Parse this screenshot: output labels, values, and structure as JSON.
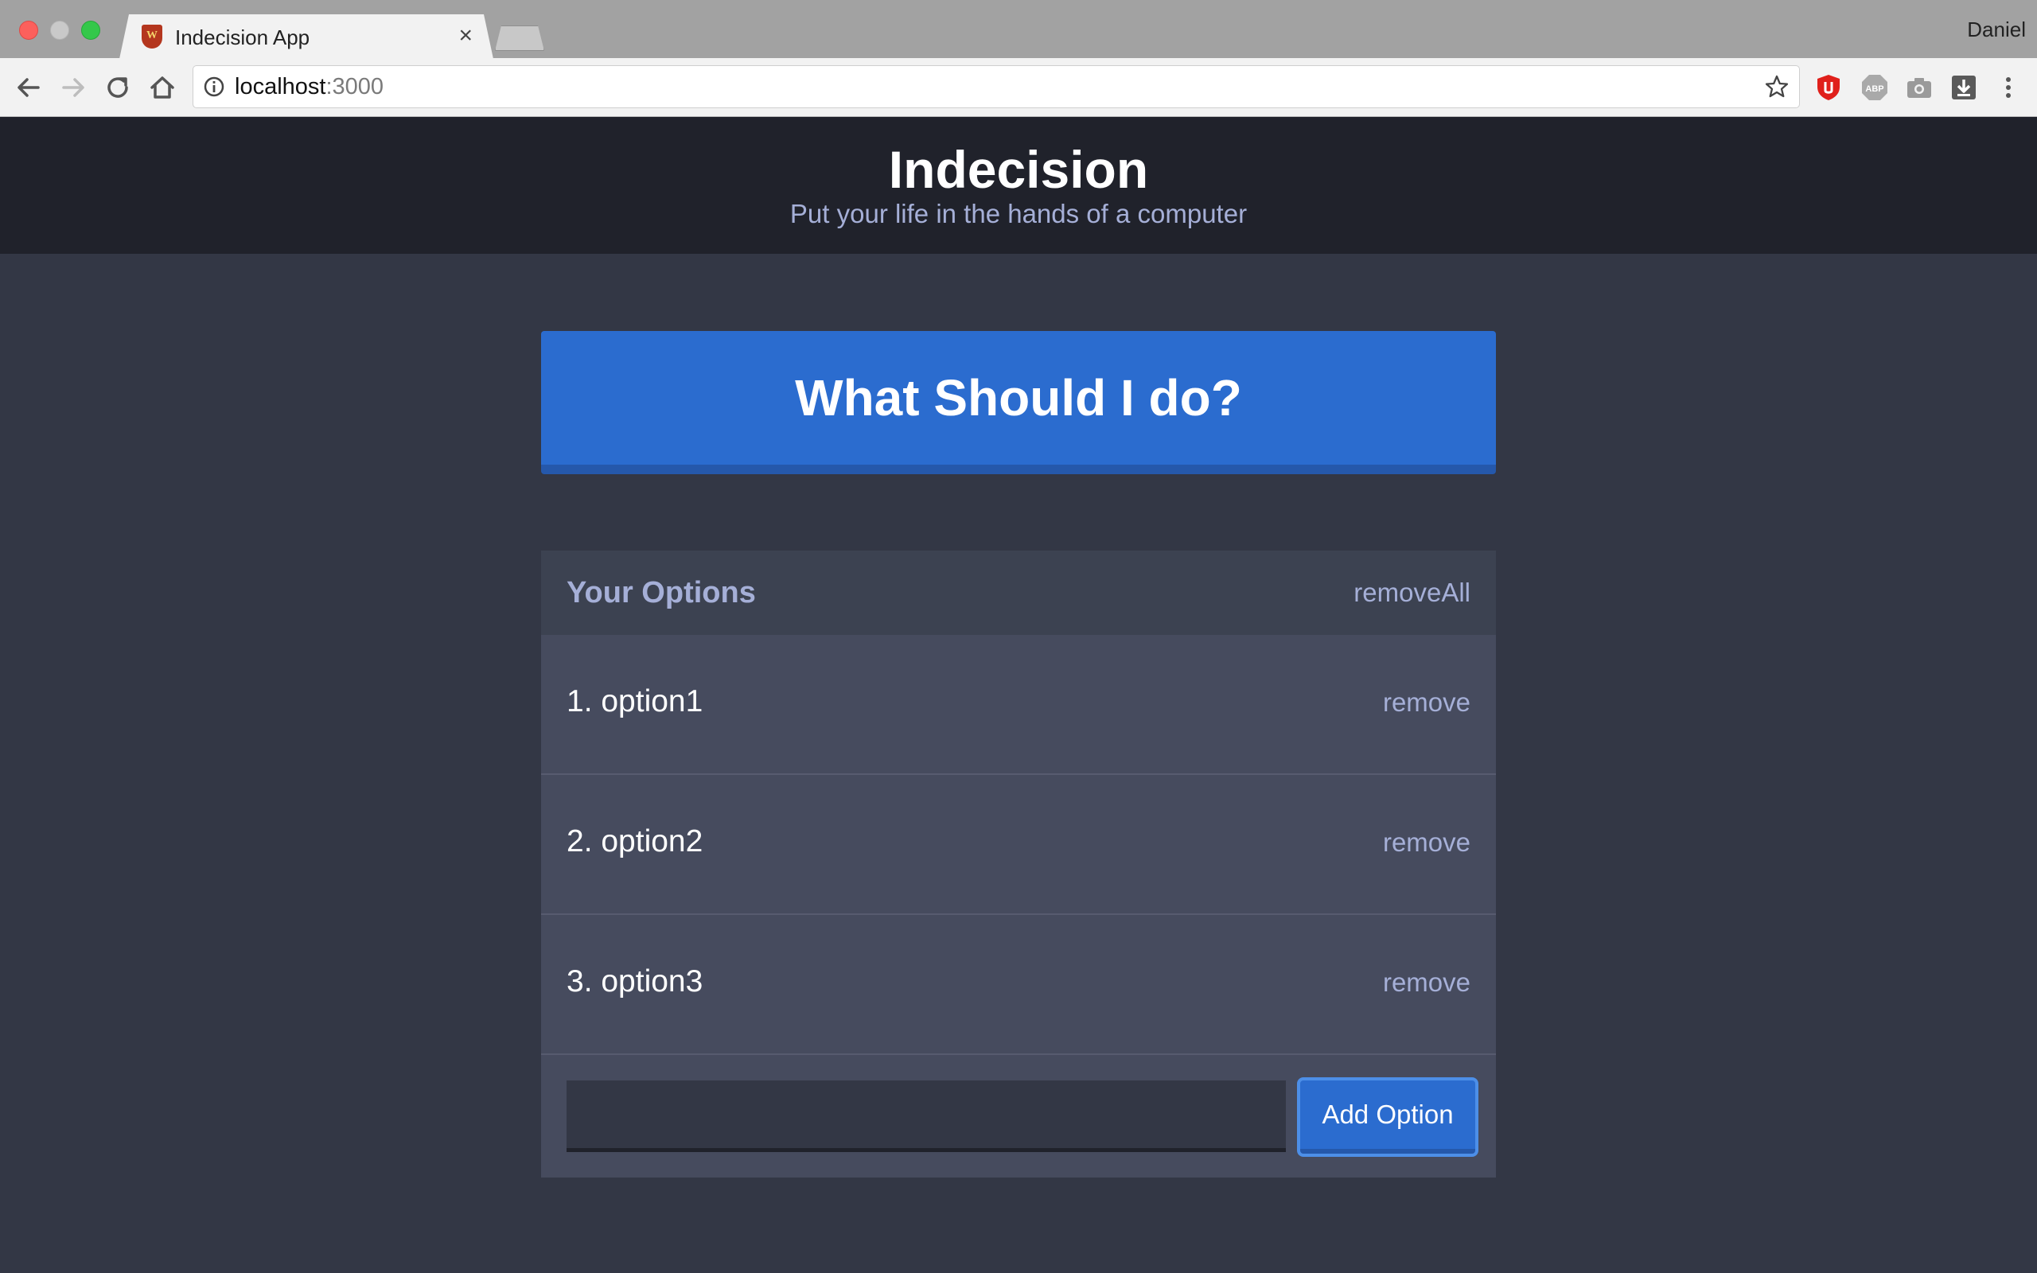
{
  "browser": {
    "tab_title": "Indecision App",
    "tab_close": "×",
    "favicon_letter": "W",
    "profile_name": "Daniel",
    "url_host": "localhost",
    "url_port": ":3000",
    "extensions": [
      "ublock-icon",
      "adblock-plus-icon",
      "screenshot-camera-icon",
      "download-icon"
    ]
  },
  "header": {
    "title": "Indecision",
    "subtitle": "Put your life in the hands of a computer"
  },
  "action": {
    "label": "What Should I do?"
  },
  "options_panel": {
    "title": "Your Options",
    "remove_all_label": "removeAll",
    "items": [
      {
        "text": "1. option1",
        "remove_label": "remove"
      },
      {
        "text": "2. option2",
        "remove_label": "remove"
      },
      {
        "text": "3. option3",
        "remove_label": "remove"
      }
    ],
    "input_value": "",
    "add_button_label": "Add Option"
  },
  "colors": {
    "page_background": "#333745",
    "header_background": "#20222b",
    "accent_blue": "#2b6ccf",
    "muted_text": "#a5afd7",
    "panel_background": "#464b5e"
  }
}
